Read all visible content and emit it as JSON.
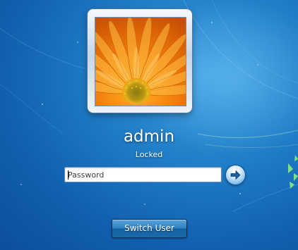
{
  "user": {
    "name": "admin",
    "status": "Locked",
    "tile_image": "orange-gerbera-flower"
  },
  "password": {
    "placeholder": "Password",
    "value": ""
  },
  "buttons": {
    "submit_icon": "arrow-right-icon",
    "switch_user_label": "Switch User"
  },
  "colors": {
    "wallpaper_blue": "#1f7cc6",
    "accent_green": "#7fe08a",
    "petal_orange": "#f07a0c"
  }
}
